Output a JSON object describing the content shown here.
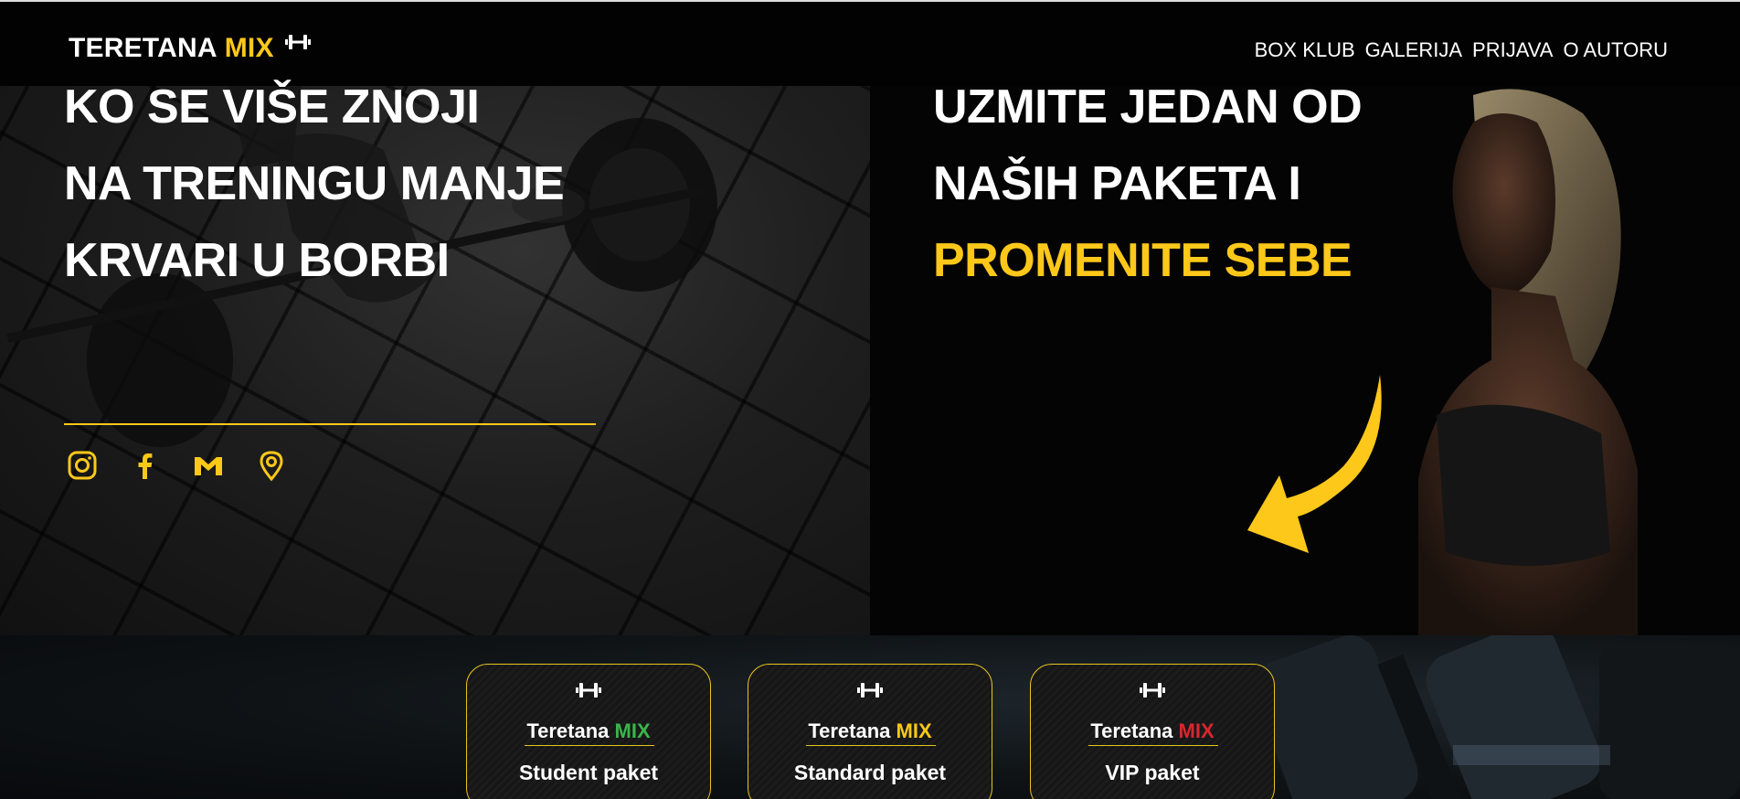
{
  "brand": {
    "word": "TERETANA",
    "accent": "MIX",
    "icon": "dumbbell-icon"
  },
  "nav": {
    "items": [
      "BOX KLUB",
      "GALERIJA",
      "PRIJAVA",
      "O AUTORU"
    ]
  },
  "hero_left": {
    "lines": [
      "KO SE VIŠE ZNOJI",
      "NA TRENINGU MANJE",
      "KRVARI U BORBI"
    ]
  },
  "hero_right": {
    "lines": [
      "UZMITE JEDAN OD",
      "NAŠIH PAKETA I"
    ],
    "highlight": "PROMENITE SEBE",
    "arrow_icon": "curved-arrow-icon"
  },
  "socials": [
    "instagram-icon",
    "facebook-icon",
    "gmail-icon",
    "location-icon"
  ],
  "packages": [
    {
      "brand": "Teretana",
      "accent": "MIX",
      "accent_color": "#3bb54a",
      "name": "Student paket"
    },
    {
      "brand": "Teretana",
      "accent": "MIX",
      "accent_color": "#fdc81a",
      "name": "Standard paket"
    },
    {
      "brand": "Teretana",
      "accent": "MIX",
      "accent_color": "#d8272d",
      "name": "VIP paket"
    }
  ],
  "colors": {
    "accent": "#fdc81a",
    "background": "#000000"
  }
}
